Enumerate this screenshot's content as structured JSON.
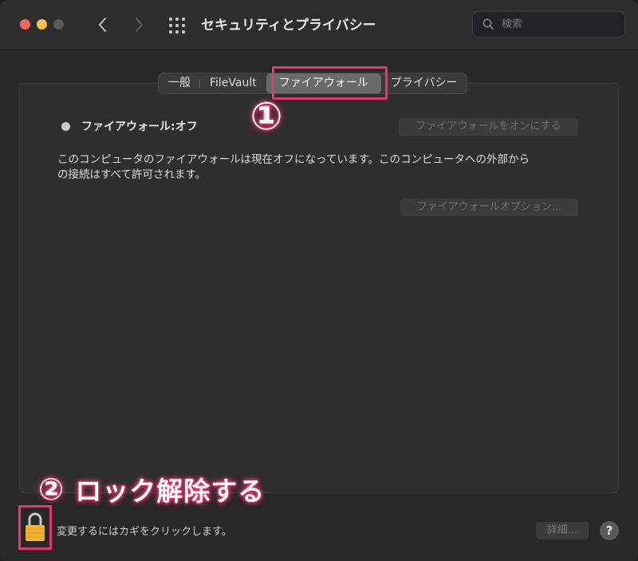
{
  "window": {
    "title": "セキュリティとプライバシー",
    "search_placeholder": "検索"
  },
  "toolbar": {
    "back_icon": "chevron-left-icon",
    "forward_icon": "chevron-right-icon",
    "grid_icon": "grid-icon"
  },
  "tabs": [
    {
      "label": "一般",
      "active": false
    },
    {
      "label": "FileVault",
      "active": false
    },
    {
      "label": "ファイアウォール",
      "active": true
    },
    {
      "label": "プライバシー",
      "active": false
    }
  ],
  "firewall": {
    "status_label": "ファイアウォール:オフ",
    "turn_on_button": "ファイアウォールをオンにする",
    "description_line1": "このコンピュータのファイアウォールは現在オフになっています。このコンピュータへの外部から",
    "description_line2": "の接続はすべて許可されます。",
    "options_button": "ファイアウォールオプション..."
  },
  "footer": {
    "lock_hint": "変更するにはカギをクリックします。",
    "details_button": "詳細...",
    "help_button": "?"
  },
  "annotations": {
    "step1": "①",
    "step2_number": "②",
    "step2_text": "ロック解除する"
  },
  "colors": {
    "highlight": "#e8356f",
    "lock": "#f2b233"
  }
}
